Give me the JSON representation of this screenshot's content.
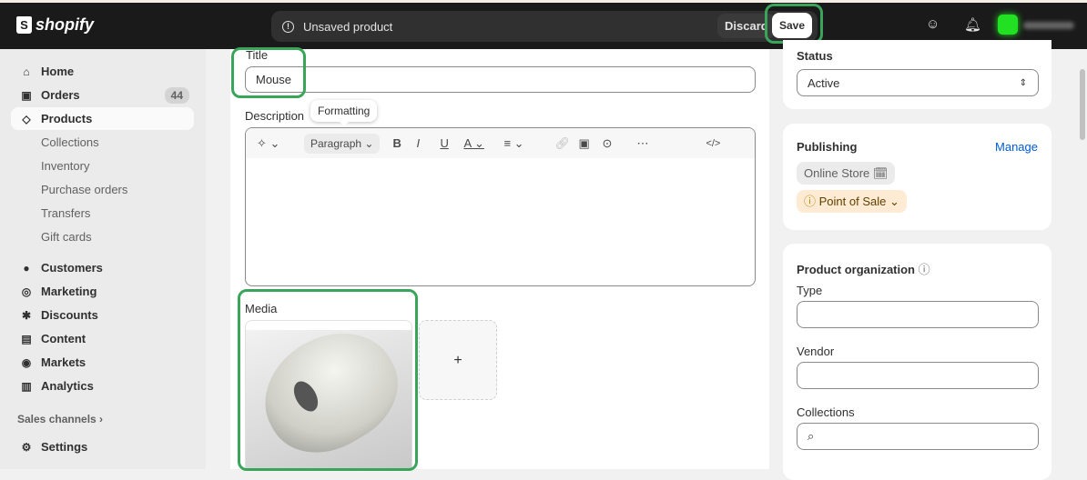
{
  "topbar": {
    "brand": "shopify",
    "unsaved": "Unsaved product",
    "discard": "Discard",
    "save": "Save"
  },
  "sidebar": {
    "items": [
      {
        "label": "Home",
        "icon": "home-icon",
        "glyph": "⌂"
      },
      {
        "label": "Orders",
        "icon": "inbox-icon",
        "glyph": "▣",
        "badge": "44"
      },
      {
        "label": "Products",
        "icon": "tag-icon",
        "glyph": "◇"
      },
      {
        "label": "Collections",
        "sub": true
      },
      {
        "label": "Inventory",
        "sub": true
      },
      {
        "label": "Purchase orders",
        "sub": true
      },
      {
        "label": "Transfers",
        "sub": true
      },
      {
        "label": "Gift cards",
        "sub": true
      },
      {
        "label": "Customers",
        "icon": "person-icon",
        "glyph": "●"
      },
      {
        "label": "Marketing",
        "icon": "target-icon",
        "glyph": "◎"
      },
      {
        "label": "Discounts",
        "icon": "discount-icon",
        "glyph": "✱"
      },
      {
        "label": "Content",
        "icon": "content-icon",
        "glyph": "▤"
      },
      {
        "label": "Markets",
        "icon": "globe-icon",
        "glyph": "◉"
      },
      {
        "label": "Analytics",
        "icon": "chart-icon",
        "glyph": "▥"
      }
    ],
    "sales_channels": "Sales channels ›",
    "settings": "Settings"
  },
  "main": {
    "title_label": "Title",
    "title_value": "Mouse",
    "description_label": "Description",
    "tooltip": "Formatting",
    "paragraph": "Paragraph",
    "media_label": "Media",
    "add": "+"
  },
  "status": {
    "label": "Status",
    "value": "Active"
  },
  "publishing": {
    "label": "Publishing",
    "manage": "Manage",
    "online_store": "Online Store",
    "pos": "Point of Sale"
  },
  "organization": {
    "label": "Product organization",
    "type": "Type",
    "vendor": "Vendor",
    "collections": "Collections"
  },
  "colors": {
    "accent": "#005bd3",
    "highlight": "#3aa55a"
  }
}
